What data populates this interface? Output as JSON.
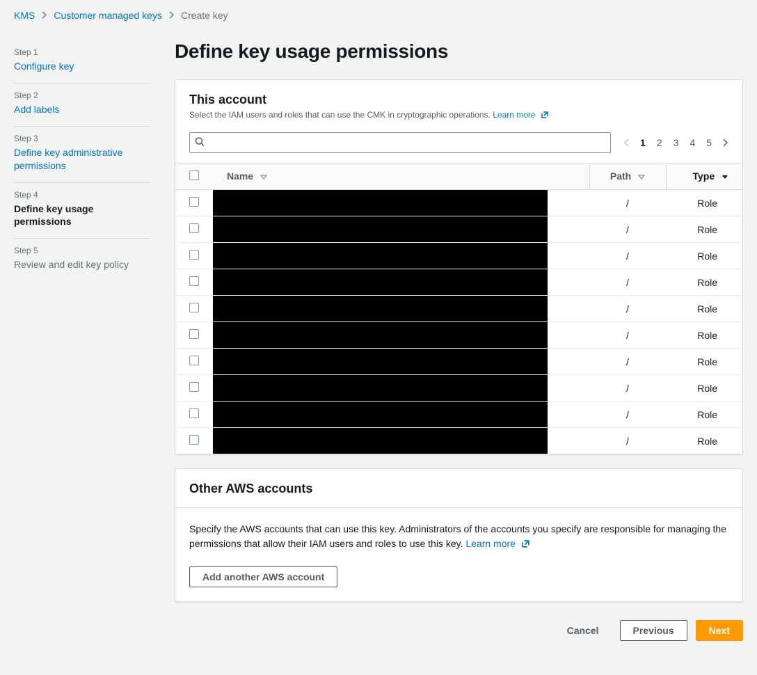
{
  "breadcrumb": {
    "root": "KMS",
    "parent": "Customer managed keys",
    "current": "Create key"
  },
  "steps": [
    {
      "num": "Step 1",
      "title": "Configure key",
      "state": "link"
    },
    {
      "num": "Step 2",
      "title": "Add labels",
      "state": "link"
    },
    {
      "num": "Step 3",
      "title": "Define key administrative permissions",
      "state": "link"
    },
    {
      "num": "Step 4",
      "title": "Define key usage permissions",
      "state": "active"
    },
    {
      "num": "Step 5",
      "title": "Review and edit key policy",
      "state": "disabled"
    }
  ],
  "page_title": "Define key usage permissions",
  "this_account": {
    "heading": "This account",
    "desc": "Select the IAM users and roles that can use the CMK in cryptographic operations.",
    "learn_more": "Learn more",
    "search_placeholder": "",
    "columns": {
      "name": "Name",
      "path": "Path",
      "type": "Type"
    },
    "pages": [
      "1",
      "2",
      "3",
      "4",
      "5"
    ],
    "current_page": "1",
    "rows": [
      {
        "name": "",
        "path": "/",
        "type": "Role"
      },
      {
        "name": "",
        "path": "/",
        "type": "Role"
      },
      {
        "name": "",
        "path": "/",
        "type": "Role"
      },
      {
        "name": "",
        "path": "/",
        "type": "Role"
      },
      {
        "name": "",
        "path": "/",
        "type": "Role"
      },
      {
        "name": "",
        "path": "/",
        "type": "Role"
      },
      {
        "name": "",
        "path": "/",
        "type": "Role"
      },
      {
        "name": "",
        "path": "/",
        "type": "Role"
      },
      {
        "name": "",
        "path": "/",
        "type": "Role"
      },
      {
        "name": "",
        "path": "/",
        "type": "Role"
      }
    ]
  },
  "other_accounts": {
    "heading": "Other AWS accounts",
    "desc": "Specify the AWS accounts that can use this key. Administrators of the accounts you specify are responsible for managing the permissions that allow their IAM users and roles to use this key.",
    "learn_more": "Learn more",
    "add_button": "Add another AWS account"
  },
  "footer": {
    "cancel": "Cancel",
    "previous": "Previous",
    "next": "Next"
  }
}
